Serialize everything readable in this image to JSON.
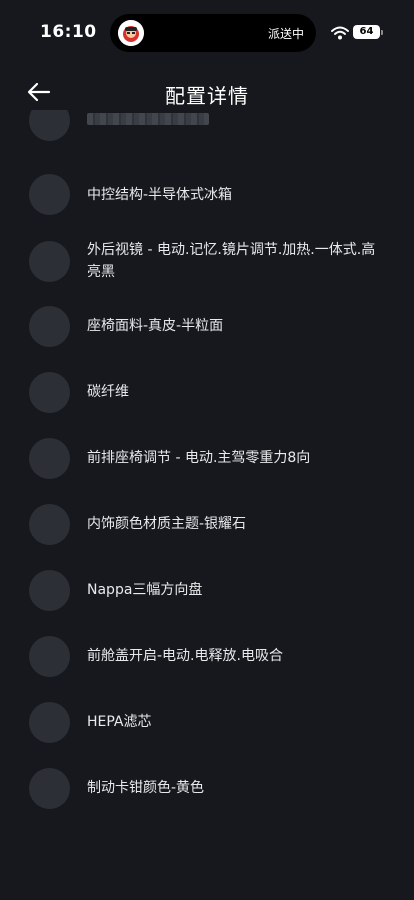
{
  "status_bar": {
    "time": "16:10",
    "island_status": "派送中",
    "battery": "64"
  },
  "header": {
    "title": "配置详情",
    "back_icon": "arrow-left-icon"
  },
  "items": [
    {
      "label": "中控结构-半导体式冰箱"
    },
    {
      "label": "外后视镜 - 电动.记忆.镜片调节.加热.一体式.高亮黑"
    },
    {
      "label": "座椅面料-真皮-半粒面"
    },
    {
      "label": "碳纤维"
    },
    {
      "label": "前排座椅调节 - 电动.主驾零重力8向"
    },
    {
      "label": "内饰颜色材质主题-银耀石"
    },
    {
      "label": "Nappa三幅方向盘"
    },
    {
      "label": "前舱盖开启-电动.电释放.电吸合"
    },
    {
      "label": "HEPA滤芯"
    },
    {
      "label": "制动卡钳颜色-黄色"
    }
  ],
  "colors": {
    "background": "#16181d",
    "icon_placeholder": "#2c2f35",
    "text": "#e8e9eb"
  }
}
